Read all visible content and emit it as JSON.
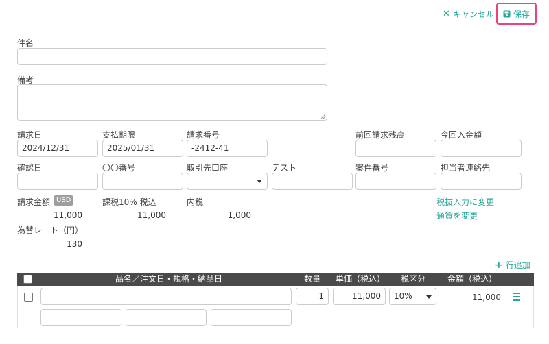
{
  "toolbar": {
    "cancel_label": "キャンセル",
    "save_label": "保存",
    "accent_color": "#26a69a",
    "highlight_color": "#e8457c",
    "cancel_icon": "close-icon",
    "save_icon": "floppy-disk-icon"
  },
  "form": {
    "subject": {
      "label": "件名",
      "value": ""
    },
    "remarks": {
      "label": "備考",
      "value": ""
    },
    "invoice_date": {
      "label": "請求日",
      "value": "2024/12/31"
    },
    "due_date": {
      "label": "支払期限",
      "value": "2025/01/31"
    },
    "invoice_number": {
      "label": "請求番号",
      "value": "-2412-41"
    },
    "prev_balance": {
      "label": "前回請求残高",
      "value": ""
    },
    "this_payment": {
      "label": "今回入金額",
      "value": ""
    },
    "confirm_date": {
      "label": "確認日",
      "value": ""
    },
    "oo_number": {
      "label": "〇〇番号",
      "value": ""
    },
    "bank_account": {
      "label": "取引先口座",
      "value": ""
    },
    "test": {
      "label": "テスト",
      "value": ""
    },
    "project_number": {
      "label": "案件番号",
      "value": ""
    },
    "contact": {
      "label": "担当者連絡先",
      "value": ""
    }
  },
  "summary": {
    "amount_label": "請求金額",
    "currency_badge": "USD",
    "amount_value": "11,000",
    "taxable_label": "課税10% 税込",
    "taxable_value": "11,000",
    "inner_tax_label": "内税",
    "inner_tax_value": "1,000",
    "exchange_label": "為替レート（円）",
    "exchange_value": "130",
    "change_tax_link": "税抜入力に変更",
    "change_currency_link": "通貨を変更"
  },
  "items": {
    "add_row_label": "行追加",
    "add_icon": "plus-icon",
    "menu_icon": "hamburger-icon",
    "headers": {
      "name": "品名／注文日・規格・納品日",
      "qty": "数量",
      "unit_price": "単価（税込）",
      "tax_class": "税区分",
      "amount": "金額（税込）"
    },
    "rows": [
      {
        "name": "",
        "qty": "1",
        "unit_price": "11,000",
        "tax_class": "10%",
        "amount": "11,000",
        "sub_fields": [
          "",
          "",
          ""
        ]
      }
    ]
  }
}
